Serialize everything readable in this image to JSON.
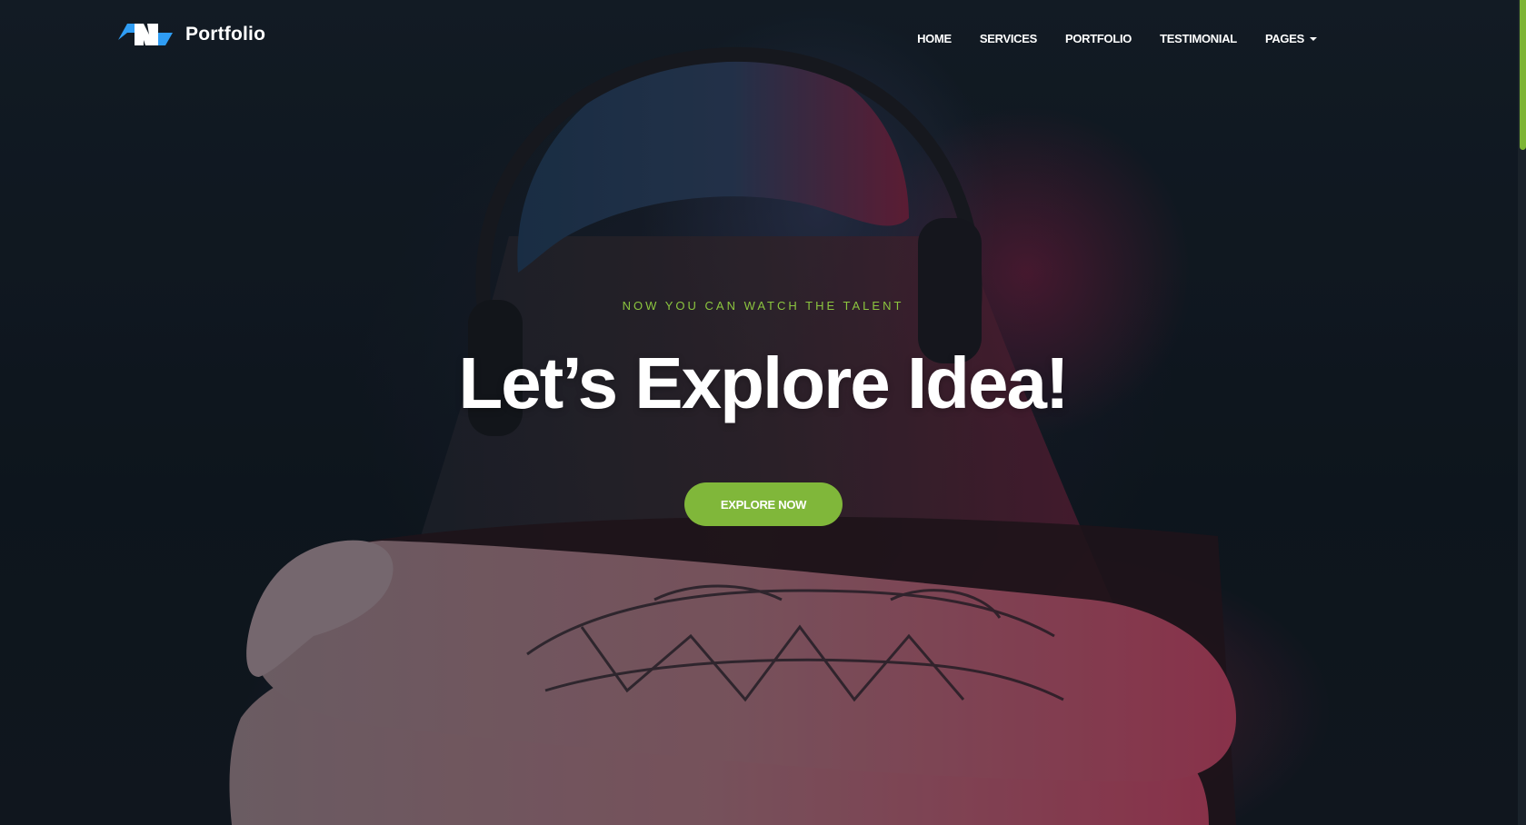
{
  "brand": {
    "name": "Portfolio",
    "logo_icon": "brand-logo-icon"
  },
  "nav": {
    "items": [
      {
        "label": "HOME"
      },
      {
        "label": "SERVICES"
      },
      {
        "label": "PORTFOLIO"
      },
      {
        "label": "TESTIMONIAL"
      },
      {
        "label": "PAGES",
        "icon": "caret-down-icon"
      }
    ]
  },
  "hero": {
    "tagline": "NOW YOU CAN WATCH THE TALENT",
    "title": "Let’s Explore Idea!",
    "button_label": "EXPLORE NOW",
    "background_image": "person-with-headphones-and-tattooed-arm-photo"
  },
  "colors": {
    "accent": "#80b73a",
    "tagline": "#8cc63f",
    "text": "#ffffff",
    "scroll_thumb": "#7db534"
  }
}
